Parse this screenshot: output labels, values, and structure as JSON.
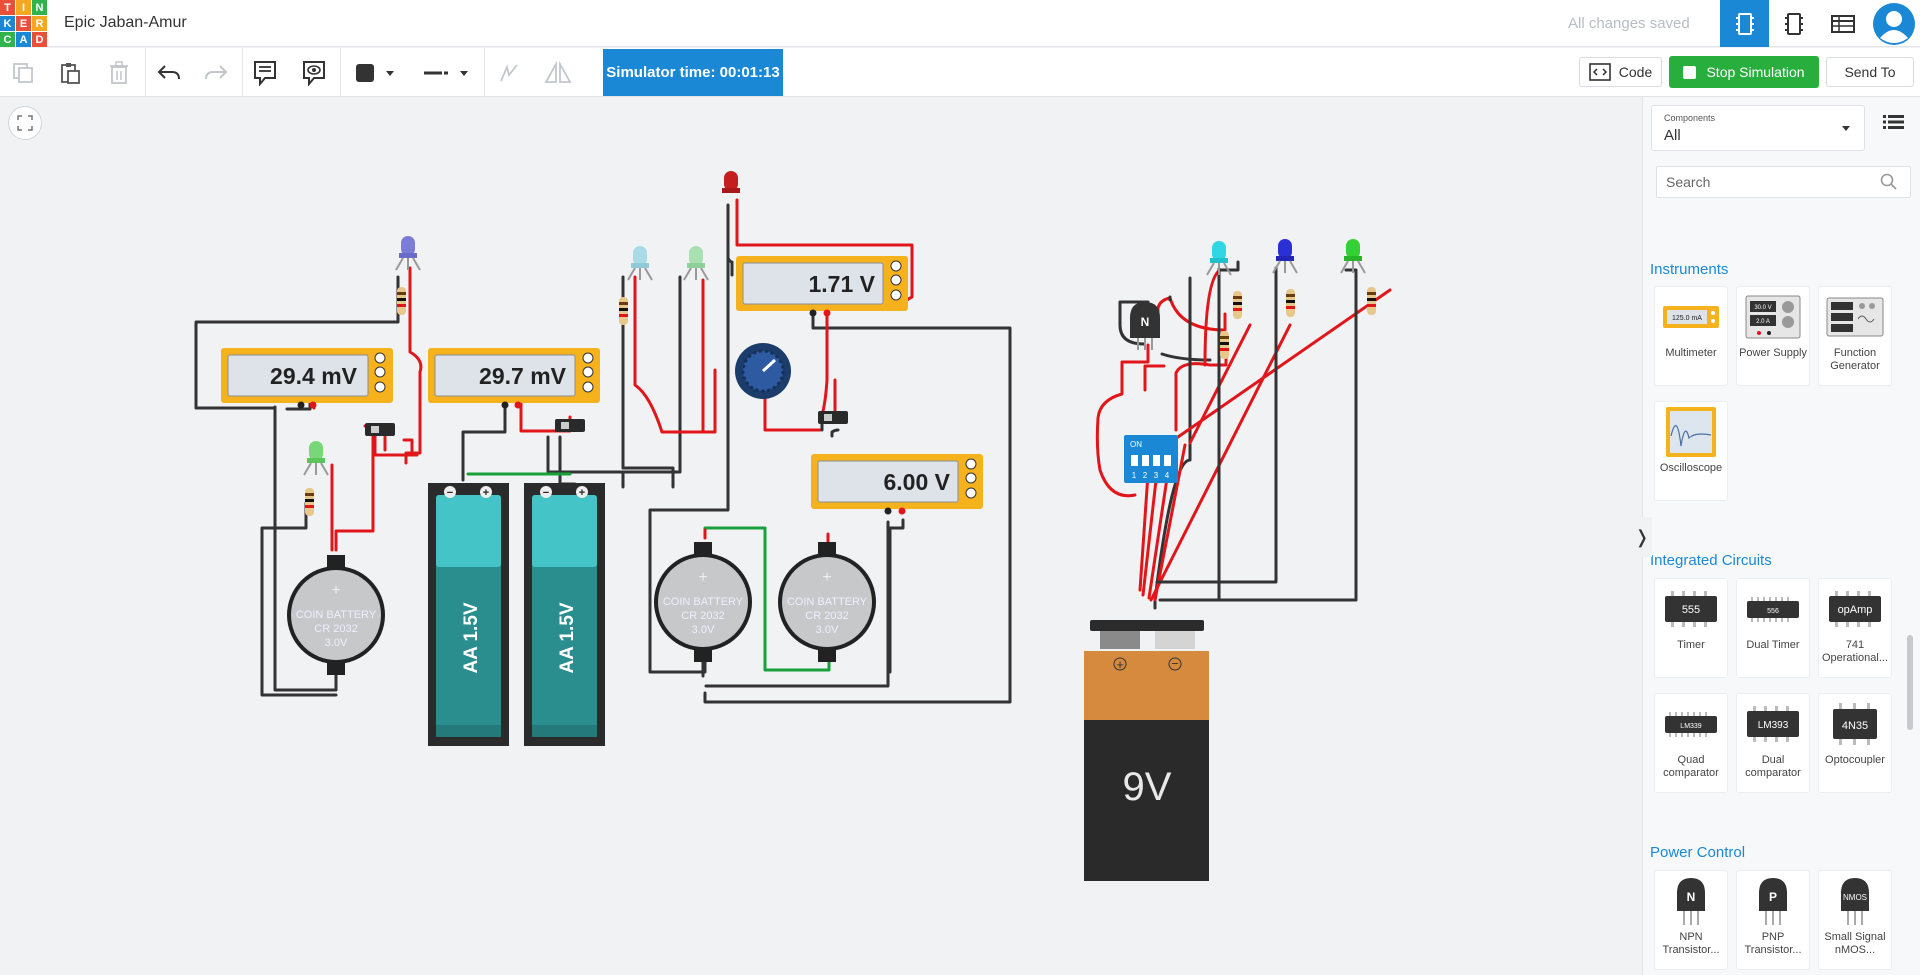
{
  "app": {
    "logo_letters": [
      "T",
      "I",
      "N",
      "K",
      "E",
      "R",
      "C",
      "A",
      "D"
    ],
    "logo_colors": [
      "#e8503a",
      "#f5a623",
      "#2fb34a",
      "#1b88d6",
      "#e8503a",
      "#f5a623",
      "#2fb34a",
      "#1b88d6",
      "#e8503a"
    ],
    "project_title": "Epic Jaban-Amur",
    "save_status": "All changes saved"
  },
  "toolbar": {
    "simulator_time": "Simulator time: 00:01:13",
    "code_label": "Code",
    "stop_label": "Stop Simulation",
    "send_label": "Send To"
  },
  "canvas": {
    "meters": [
      "29.4 mV",
      "29.7 mV",
      "1.71 V",
      "6.00 V"
    ],
    "meter_modes": [
      "A",
      "V",
      "R"
    ],
    "coin_battery_lines": [
      "COIN BATTERY",
      "CR 2032",
      "3.0V"
    ],
    "aa_battery_label": "AA 1.5V",
    "nine_volt_label": "9V",
    "dip_switch_on": "ON",
    "dip_switch_numbers": [
      "1",
      "2",
      "3",
      "4"
    ],
    "transistor_label": "N"
  },
  "panel": {
    "dropdown_label": "Components",
    "dropdown_value": "All",
    "search_placeholder": "Search",
    "sections": {
      "instruments": {
        "title": "Instruments",
        "items": [
          "Multimeter",
          "Power Supply",
          "Function Generator",
          "Oscilloscope"
        ],
        "multimeter_display": "125.0 mA",
        "power_supply_readouts": [
          "30.0 V",
          "2.0 A"
        ]
      },
      "integrated_circuits": {
        "title": "Integrated Circuits",
        "items": [
          "Timer",
          "Dual Timer",
          "741 Operational...",
          "Quad comparator",
          "Dual comparator",
          "Optocoupler"
        ],
        "chip_labels": [
          "555",
          "556",
          "opAmp",
          "LM339",
          "LM393",
          "4N35"
        ]
      },
      "power_control": {
        "title": "Power Control",
        "items": [
          "NPN Transistor...",
          "PNP Transistor...",
          "Small Signal nMOS..."
        ],
        "chip_labels": [
          "N",
          "P",
          "NMOS"
        ]
      }
    }
  }
}
